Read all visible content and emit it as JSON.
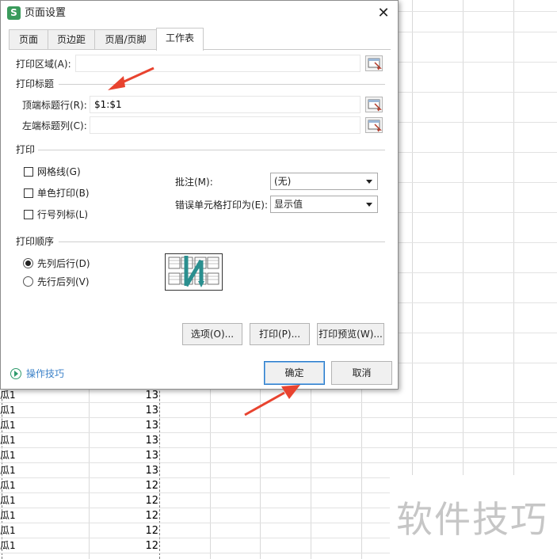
{
  "dialog": {
    "title": "页面设置",
    "close_glyph": "✕",
    "app_icon_glyph": "S",
    "tabs": [
      {
        "label": "页面",
        "active": false
      },
      {
        "label": "页边距",
        "active": false
      },
      {
        "label": "页眉/页脚",
        "active": false
      },
      {
        "label": "工作表",
        "active": true
      }
    ],
    "print_area": {
      "label": "打印区域(A):",
      "value": ""
    },
    "print_titles": {
      "section": "打印标题",
      "top_rows": {
        "label": "顶端标题行(R):",
        "value": "$1:$1"
      },
      "left_cols": {
        "label": "左端标题列(C):",
        "value": ""
      }
    },
    "print": {
      "section": "打印",
      "gridlines": {
        "label": "网格线(G)",
        "checked": false
      },
      "mono": {
        "label": "单色打印(B)",
        "checked": false
      },
      "row_col_headers": {
        "label": "行号列标(L)",
        "checked": false
      },
      "comments": {
        "label": "批注(M):",
        "value": "(无)"
      },
      "errors": {
        "label": "错误单元格打印为(E):",
        "value": "显示值"
      }
    },
    "order": {
      "section": "打印顺序",
      "down_then_over": {
        "label": "先列后行(D)",
        "selected": true
      },
      "over_then_down": {
        "label": "先行后列(V)",
        "selected": false
      }
    },
    "buttons": {
      "options": "选项(O)...",
      "print": "打印(P)...",
      "preview": "打印预览(W)...",
      "ok": "确定",
      "cancel": "取消"
    },
    "tips": "操作技巧"
  },
  "sheet": {
    "col_a": [
      "瓜1",
      "瓜1",
      "瓜1",
      "瓜1",
      "瓜1",
      "瓜1",
      "瓜1",
      "瓜1",
      "瓜1",
      "瓜1",
      "瓜1"
    ],
    "col_b": [
      "13",
      "13",
      "13",
      "13",
      "13",
      "13",
      "12",
      "12",
      "12",
      "12",
      "12"
    ]
  },
  "watermark": "软件技巧",
  "colors": {
    "accent_blue": "#2a7ac8",
    "tips_green": "#2e9a6c",
    "arrow_red": "#e8432f"
  }
}
